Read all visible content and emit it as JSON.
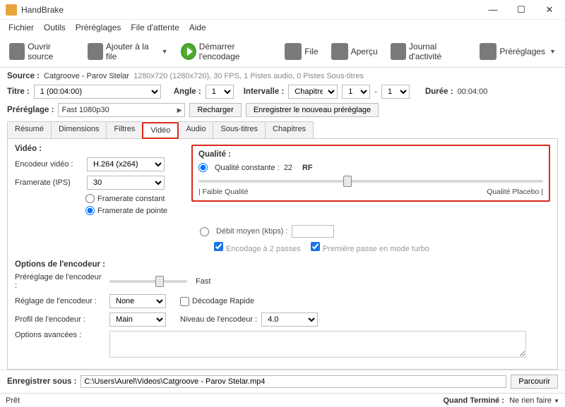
{
  "window": {
    "title": "HandBrake"
  },
  "menubar": [
    "Fichier",
    "Outils",
    "Préréglages",
    "File d'attente",
    "Aide"
  ],
  "toolbar": {
    "open": "Ouvrir source",
    "add_queue": "Ajouter à la file",
    "start": "Démarrer l'encodage",
    "queue": "File",
    "preview": "Aperçu",
    "log": "Journal d'activité",
    "presets": "Préréglages"
  },
  "source": {
    "label": "Source :",
    "name": "Catgroove - Parov Stelar",
    "details": "1280x720 (1280x720), 30 FPS, 1 Pistes audio, 0 Pistes Sous-titres"
  },
  "title": {
    "label": "Titre :",
    "value": "1  (00:04:00)",
    "angle_label": "Angle :",
    "angle_value": "1",
    "interval_label": "Intervalle :",
    "interval_type": "Chapitres",
    "from": "1",
    "to_sep": "-",
    "to": "1",
    "duration_label": "Durée :",
    "duration": "00:04:00"
  },
  "preset": {
    "label": "Préréglage :",
    "value": "Fast 1080p30",
    "reload": "Recharger",
    "save": "Enregistrer le nouveau préréglage"
  },
  "tabs": [
    "Résumé",
    "Dimensions",
    "Filtres",
    "Vidéo",
    "Audio",
    "Sous-titres",
    "Chapitres"
  ],
  "video": {
    "header": "Vidéo :",
    "encoder_label": "Encodeur vidéo :",
    "encoder_value": "H.264 (x264)",
    "fps_label": "Framerate (IPS)",
    "fps_value": "30",
    "cfr": "Framerate constant",
    "pfr": "Framerate de pointe"
  },
  "quality": {
    "header": "Qualité :",
    "cq_label": "Qualité constante :",
    "cq_value": "22",
    "cq_units": "RF",
    "low": "| Faible Qualité",
    "high": "Qualité Placebo |",
    "bitrate_label": "Débit moyen (kbps) :",
    "twopass": "Encodage à 2 passes",
    "turbo": "Première passe en mode turbo"
  },
  "encoder_opts": {
    "header": "Options de l'encodeur :",
    "preset_label": "Préréglage de l'encodeur :",
    "preset_value": "Fast",
    "tune_label": "Réglage de l'encodeur :",
    "tune_value": "None",
    "fastdecode": "Décodage Rapide",
    "profile_label": "Profil de l'encodeur :",
    "profile_value": "Main",
    "level_label": "Niveau de l'encodeur :",
    "level_value": "4.0",
    "advanced_label": "Options avancées :"
  },
  "output": {
    "label": "Enregistrer sous :",
    "path": "C:\\Users\\Aurel\\Videos\\Catgroove - Parov Stelar.mp4",
    "browse": "Parcourir"
  },
  "status": {
    "ready": "Prêt",
    "when_done_label": "Quand Terminé :",
    "when_done_value": "Ne rien faire"
  }
}
